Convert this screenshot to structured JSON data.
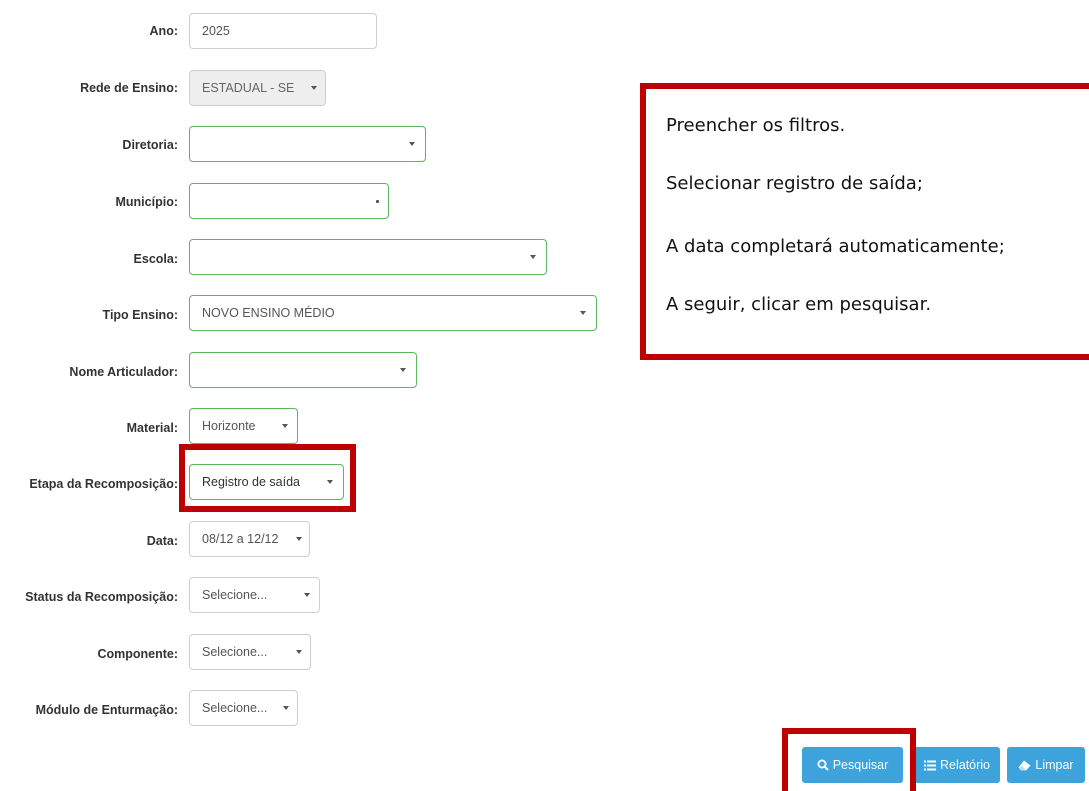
{
  "form": {
    "ano": {
      "label": "Ano:",
      "value": "2025"
    },
    "rede": {
      "label": "Rede de Ensino:",
      "value": "ESTADUAL - SE"
    },
    "diretoria": {
      "label": "Diretoria:",
      "value": ""
    },
    "municipio": {
      "label": "Município:",
      "value": ""
    },
    "escola": {
      "label": "Escola:",
      "value": ""
    },
    "tipo_ensino": {
      "label": "Tipo Ensino:",
      "value": "NOVO ENSINO MÉDIO"
    },
    "articulador": {
      "label": "Nome Articulador:",
      "value": ""
    },
    "material": {
      "label": "Material:",
      "value": "Horizonte"
    },
    "etapa": {
      "label": "Etapa da Recomposição:",
      "value": "Registro de saída"
    },
    "data": {
      "label": "Data:",
      "value": "08/12 a 12/12"
    },
    "status": {
      "label": "Status da Recomposição:",
      "value": "Selecione..."
    },
    "componente": {
      "label": "Componente:",
      "value": "Selecione..."
    },
    "modulo": {
      "label": "Módulo de Enturmação:",
      "value": "Selecione..."
    }
  },
  "instructions": [
    "Preencher os filtros.",
    "Selecionar registro de saída;",
    "A data completará automaticamente;",
    "A seguir, clicar em pesquisar."
  ],
  "buttons": {
    "pesquisar": "Pesquisar",
    "relatorio": "Relatório",
    "limpar": "Limpar"
  },
  "colors": {
    "highlight": "#c00000",
    "button": "#3da3dc",
    "valid_border": "#5cb85c"
  },
  "icons": {
    "pesquisar": "search-icon",
    "relatorio": "list-icon",
    "limpar": "eraser-icon",
    "dropdown": "caret-down-icon"
  }
}
